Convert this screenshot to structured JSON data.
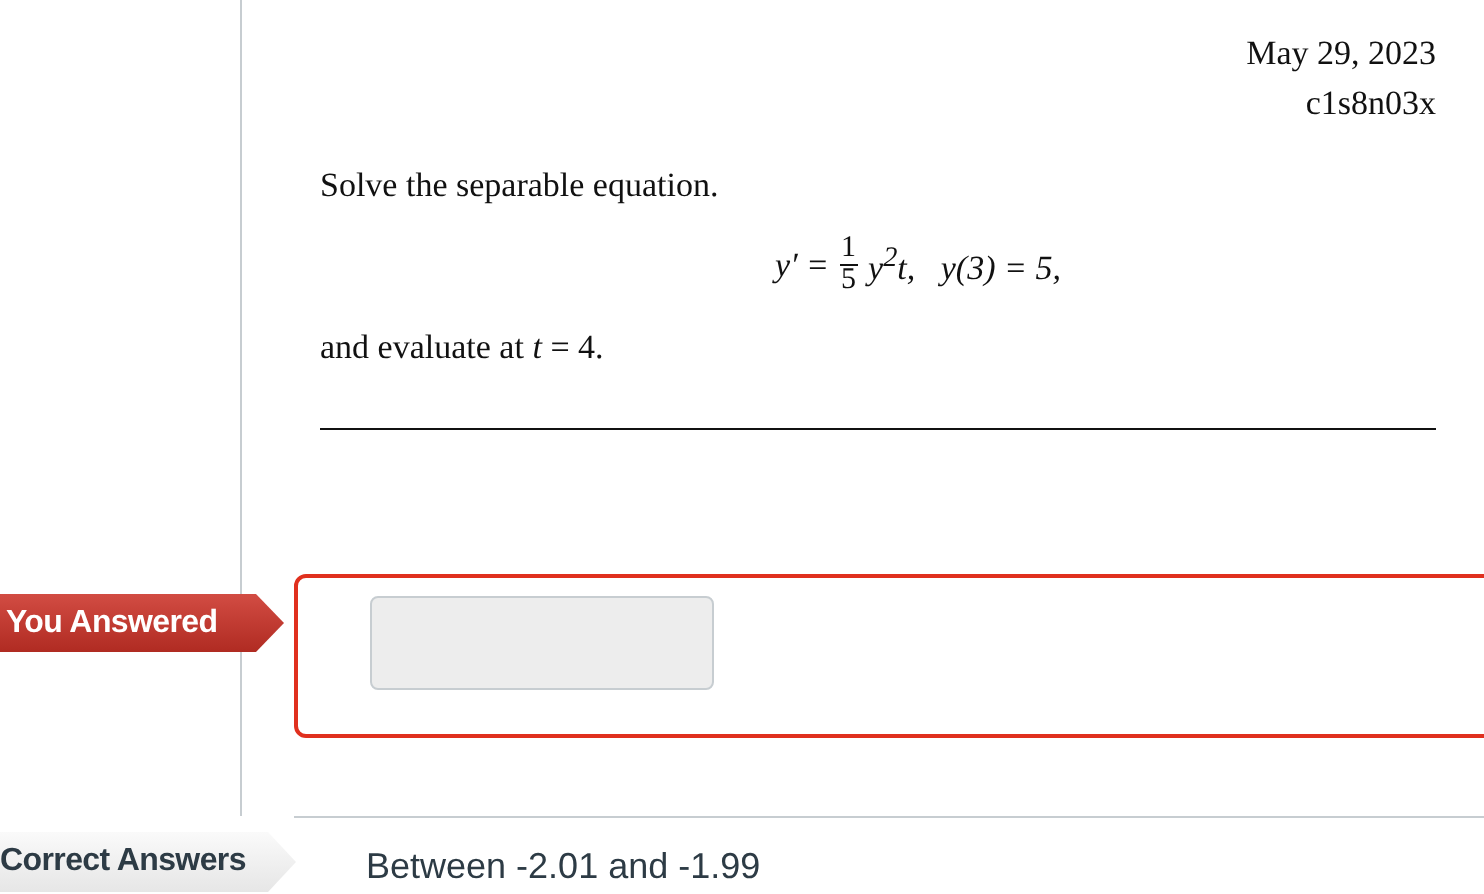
{
  "header": {
    "date": "May 29, 2023",
    "code": "c1s8n03x"
  },
  "question": {
    "prompt": "Solve the separable equation.",
    "equation": {
      "lhs": "y′ =",
      "numerator": "1",
      "denominator": "5",
      "rest": "y$^{2}$t,   y(3) = 5,"
    },
    "followup": "and evaluate at *t* = 4."
  },
  "your_answer": {
    "label": "You Answered",
    "correct": false
  },
  "correct_answer": {
    "label": "Correct Answers",
    "text": "Between -2.01 and -1.99"
  }
}
